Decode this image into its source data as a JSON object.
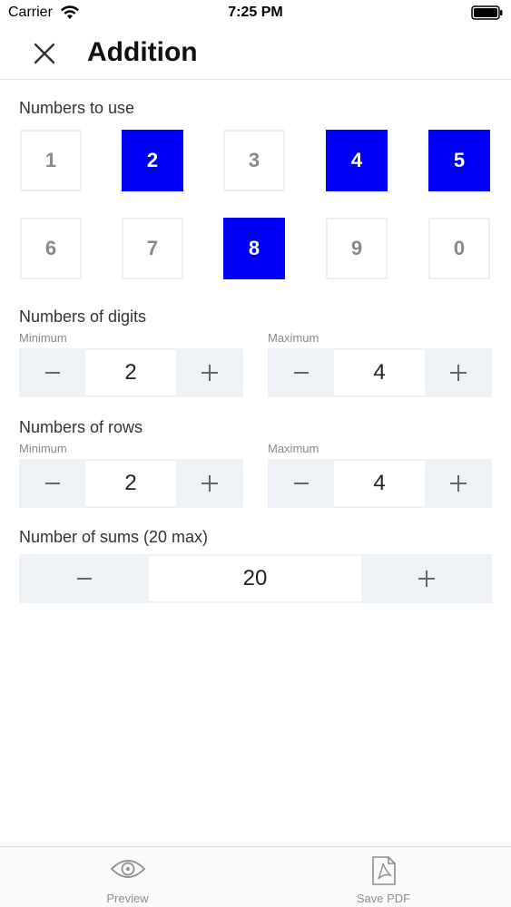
{
  "status_bar": {
    "carrier": "Carrier",
    "time": "7:25 PM",
    "icons": [
      "wifi-icon",
      "battery-icon"
    ]
  },
  "header": {
    "title": "Addition",
    "close_icon": "close-icon"
  },
  "numbers_section": {
    "label": "Numbers to use",
    "tiles": [
      {
        "label": "1",
        "selected": false
      },
      {
        "label": "2",
        "selected": true
      },
      {
        "label": "3",
        "selected": false
      },
      {
        "label": "4",
        "selected": true
      },
      {
        "label": "5",
        "selected": true
      },
      {
        "label": "6",
        "selected": false
      },
      {
        "label": "7",
        "selected": false
      },
      {
        "label": "8",
        "selected": true
      },
      {
        "label": "9",
        "selected": false
      },
      {
        "label": "0",
        "selected": false
      }
    ],
    "selected_color": "#0000f5"
  },
  "digits_section": {
    "label": "Numbers of digits",
    "min_label": "Minimum",
    "max_label": "Maximum",
    "min_value": "2",
    "max_value": "4"
  },
  "rows_section": {
    "label": "Numbers of rows",
    "min_label": "Minimum",
    "max_label": "Maximum",
    "min_value": "2",
    "max_value": "4"
  },
  "sums_section": {
    "label": "Number of sums (20 max)",
    "value": "20"
  },
  "tab_bar": {
    "preview_label": "Preview",
    "save_pdf_label": "Save PDF",
    "icons": [
      "eye-icon",
      "pdf-icon"
    ]
  }
}
